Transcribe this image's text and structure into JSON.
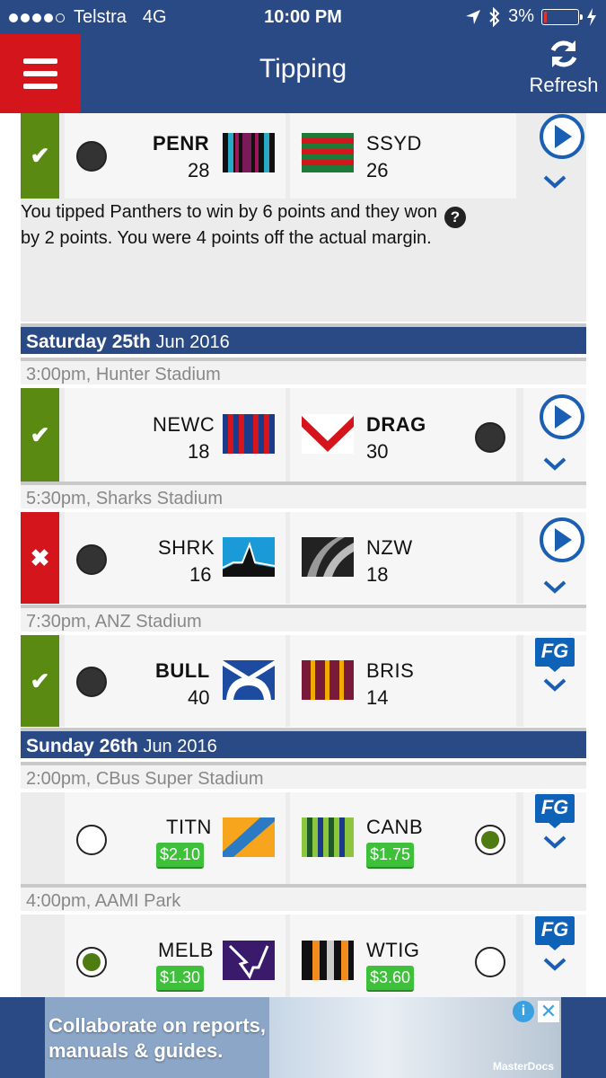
{
  "status_bar": {
    "carrier": "Telstra",
    "network": "4G",
    "time": "10:00 PM",
    "battery": "3%"
  },
  "nav": {
    "title": "Tipping",
    "refresh_label": "Refresh"
  },
  "result": {
    "text": "You tipped Panthers to win by 6 points and they won by 2 points. You were 4 points off the actual margin.",
    "help": "?"
  },
  "top_match": {
    "home": {
      "code": "PENR",
      "score": "28"
    },
    "away": {
      "code": "SSYD",
      "score": "26"
    }
  },
  "days": [
    {
      "day": "Saturday 25th",
      "date": "Jun 2016"
    },
    {
      "day": "Sunday 26th",
      "date": "Jun 2016"
    }
  ],
  "matches": [
    {
      "time": "3:00pm, Hunter Stadium",
      "home": {
        "code": "NEWC",
        "score": "18"
      },
      "away": {
        "code": "DRAG",
        "score": "30"
      }
    },
    {
      "time": "5:30pm, Sharks Stadium",
      "home": {
        "code": "SHRK",
        "score": "16"
      },
      "away": {
        "code": "NZW",
        "score": "18"
      }
    },
    {
      "time": "7:30pm, ANZ Stadium",
      "home": {
        "code": "BULL",
        "score": "40"
      },
      "away": {
        "code": "BRIS",
        "score": "14"
      }
    },
    {
      "time": "2:00pm, CBus Super Stadium",
      "home": {
        "code": "TITN",
        "odds": "$2.10"
      },
      "away": {
        "code": "CANB",
        "odds": "$1.75"
      }
    },
    {
      "time": "4:00pm, AAMI Park",
      "home": {
        "code": "MELB",
        "odds": "$1.30"
      },
      "away": {
        "code": "WTIG",
        "odds": "$3.60"
      }
    }
  ],
  "fg_label": "FG",
  "ad": {
    "line1": "Collaborate on reports,",
    "line2": "manuals & guides.",
    "brand": "MasterDocs"
  },
  "colors": {
    "nav_blue": "#2a4a86",
    "menu_red": "#d4161c",
    "correct_green": "#5b8a12",
    "odds_green": "#3fc03b",
    "play_blue": "#1a5fb4"
  }
}
